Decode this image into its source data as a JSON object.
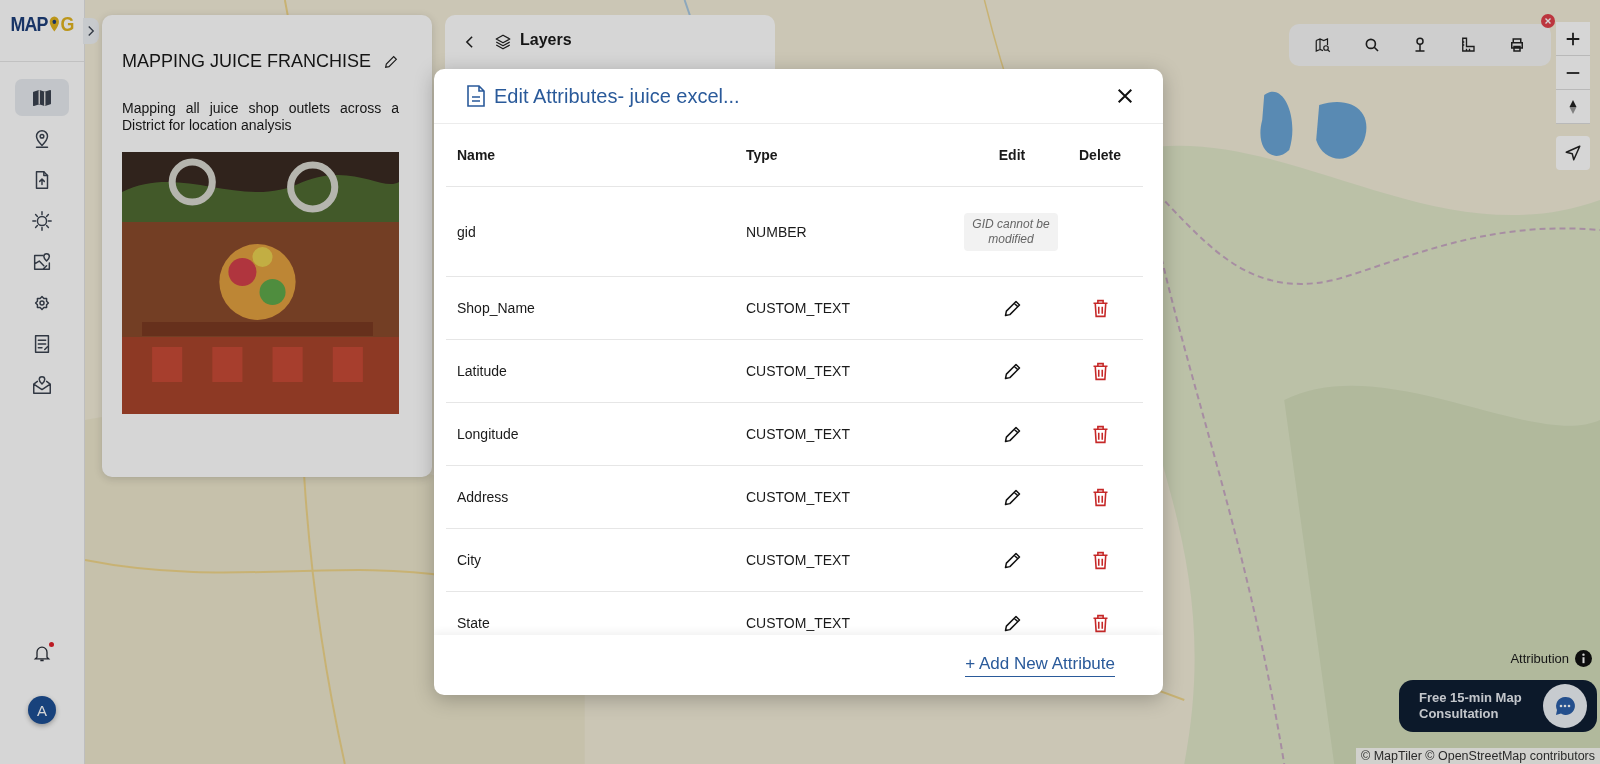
{
  "logo": {
    "lead": "MAP",
    "tail": "G"
  },
  "sidebar": {
    "items": [
      {
        "kind": "map",
        "selected": true
      },
      {
        "kind": "pin",
        "selected": false
      },
      {
        "kind": "upload",
        "selected": false
      },
      {
        "kind": "sun",
        "selected": false
      },
      {
        "kind": "mappin",
        "selected": false
      },
      {
        "kind": "eyegear",
        "selected": false
      },
      {
        "kind": "list",
        "selected": false
      },
      {
        "kind": "mail",
        "selected": false
      }
    ],
    "notifications": {
      "unread": true
    },
    "avatar": "A"
  },
  "project": {
    "title": "MAPPING JUICE FRANCHISE",
    "description": "Mapping all juice shop outlets across a District for location analysis"
  },
  "layers_panel": {
    "title": "Layers"
  },
  "modal": {
    "title": "Edit Attributes- juice excel...",
    "columns": [
      "Name",
      "Type",
      "Edit",
      "Delete"
    ],
    "rows": [
      {
        "kind": "locked",
        "name": "gid",
        "type": "NUMBER",
        "note": "GID cannot be modified"
      },
      {
        "kind": "editable",
        "name": "Shop_Name",
        "type": "CUSTOM_TEXT"
      },
      {
        "kind": "editable",
        "name": "Latitude",
        "type": "CUSTOM_TEXT"
      },
      {
        "kind": "editable",
        "name": "Longitude",
        "type": "CUSTOM_TEXT"
      },
      {
        "kind": "editable",
        "name": "Address",
        "type": "CUSTOM_TEXT"
      },
      {
        "kind": "editable",
        "name": "City",
        "type": "CUSTOM_TEXT"
      },
      {
        "kind": "editable",
        "name": "State",
        "type": "CUSTOM_TEXT"
      }
    ],
    "add_button": "+ Add New Attribute"
  },
  "attribution": {
    "label": "Attribution",
    "credits": "© MapTiler © OpenStreetMap contributors"
  },
  "consultation": {
    "label": "Free 15-min Map Consultation"
  }
}
